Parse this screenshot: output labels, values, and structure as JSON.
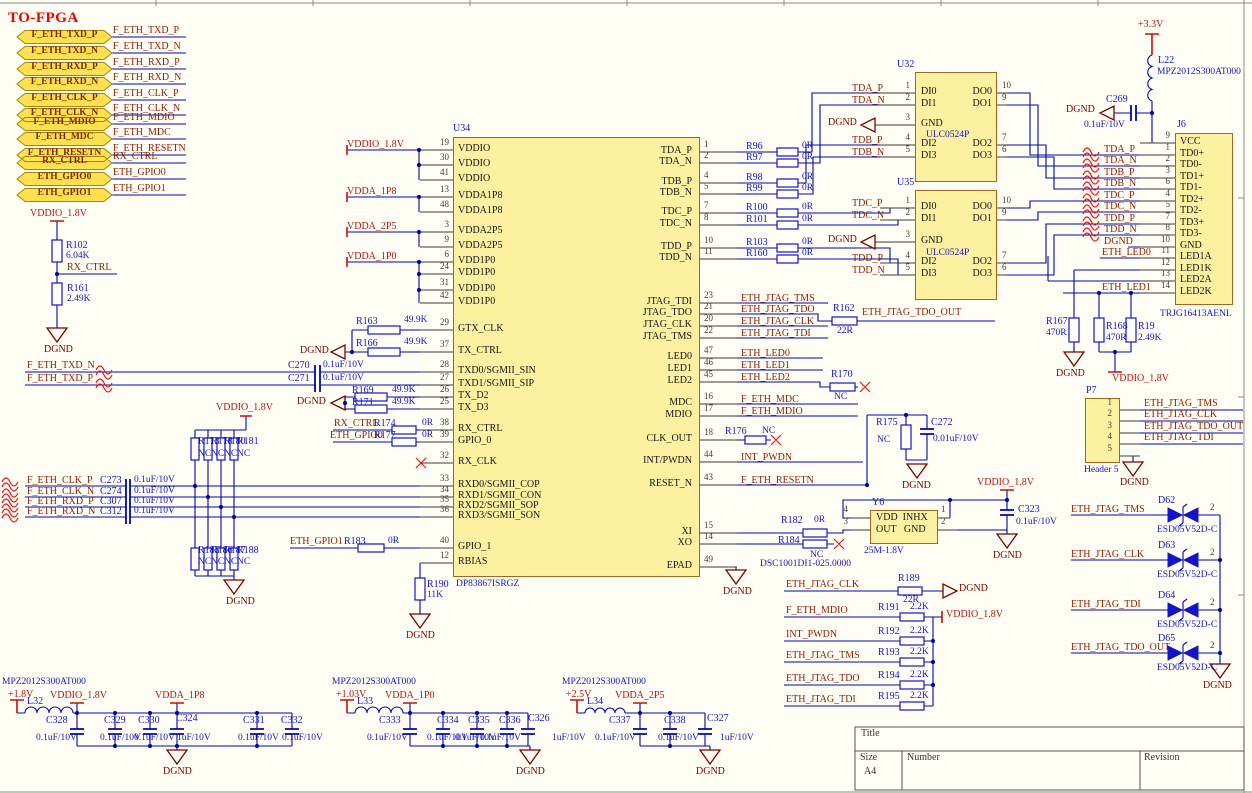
{
  "header": {
    "title": "TO-FPGA"
  },
  "ports": [
    {
      "label": "F_ETH_TXD_P"
    },
    {
      "label": "F_ETH_TXD_N"
    },
    {
      "label": "F_ETH_RXD_P"
    },
    {
      "label": "F_ETH_RXD_N"
    },
    {
      "label": "F_ETH_CLK_P"
    },
    {
      "label": "F_ETH_CLK_N"
    },
    {
      "label": "F_ETH_MDIO"
    },
    {
      "label": "F_ETH_MDC"
    },
    {
      "label": "F_ETH_RESETN"
    },
    {
      "label": "RX_CTRL"
    },
    {
      "label": "ETH_GPIO0"
    },
    {
      "label": "ETH_GPIO1"
    }
  ],
  "u34": {
    "ref": "U34",
    "part": "DP83867ISRGZ",
    "left_pins": [
      [
        "19",
        "VDDIO"
      ],
      [
        "30",
        "VDDIO"
      ],
      [
        "41",
        "VDDIO"
      ],
      [
        "13",
        "VDDA1P8"
      ],
      [
        "48",
        "VDDA1P8"
      ],
      [
        "3",
        "VDDA2P5"
      ],
      [
        "9",
        "VDDA2P5"
      ],
      [
        "6",
        "VDD1P0"
      ],
      [
        "24",
        "VDD1P0"
      ],
      [
        "31",
        "VDD1P0"
      ],
      [
        "42",
        "VDD1P0"
      ],
      [
        "29",
        "GTX_CLK"
      ],
      [
        "37",
        "TX_CTRL"
      ],
      [
        "28",
        "TXD0/SGMII_SIN"
      ],
      [
        "27",
        "TXD1/SGMII_SIP"
      ],
      [
        "26",
        "TX_D2"
      ],
      [
        "25",
        "TX_D3"
      ],
      [
        "38",
        "RX_CTRL"
      ],
      [
        "39",
        "GPIO_0"
      ],
      [
        "32",
        "RX_CLK"
      ],
      [
        "33",
        "RXD0/SGMII_COP"
      ],
      [
        "34",
        "RXD1/SGMII_CON"
      ],
      [
        "35",
        "RXD2/SGMII_SOP"
      ],
      [
        "36",
        "RXD3/SGMII_SON"
      ],
      [
        "40",
        "GPIO_1"
      ],
      [
        "12",
        "RBIAS"
      ]
    ],
    "right_pins": [
      [
        "1",
        "TDA_P"
      ],
      [
        "2",
        "TDA_N"
      ],
      [
        "4",
        "TDB_P"
      ],
      [
        "5",
        "TDB_N"
      ],
      [
        "7",
        "TDC_P"
      ],
      [
        "8",
        "TDC_N"
      ],
      [
        "10",
        "TDD_P"
      ],
      [
        "11",
        "TDD_N"
      ],
      [
        "23",
        "JTAG_TDI"
      ],
      [
        "21",
        "JTAG_TDO"
      ],
      [
        "20",
        "JTAG_CLK"
      ],
      [
        "22",
        "JTAG_TMS"
      ],
      [
        "47",
        "LED0"
      ],
      [
        "46",
        "LED1"
      ],
      [
        "45",
        "LED2"
      ],
      [
        "16",
        "MDC"
      ],
      [
        "17",
        "MDIO"
      ],
      [
        "18",
        "CLK_OUT"
      ],
      [
        "44",
        "INT/PWDN"
      ],
      [
        "43",
        "RESET_N"
      ],
      [
        "15",
        "XI"
      ],
      [
        "14",
        "XO"
      ],
      [
        "49",
        "EPAD"
      ]
    ]
  },
  "u34_right_nets": [
    "ETH_JTAG_TMS",
    "ETH_JTAG_TDO",
    "ETH_JTAG_CLK",
    "ETH_JTAG_TDI",
    "ETH_LED0",
    "ETH_LED1",
    "ETH_LED2",
    "F_ETH_MDC",
    "F_ETH_MDIO",
    "INT_PWDN",
    "F_ETH_RESETN"
  ],
  "u32": {
    "ref": "U32",
    "part": "ULC0524P",
    "left": [
      [
        "1",
        "DI0"
      ],
      [
        "2",
        "DI1"
      ],
      [
        "3",
        "GND"
      ],
      [
        "4",
        "DI2"
      ],
      [
        "5",
        "DI3"
      ]
    ],
    "right": [
      [
        "10",
        "DO0"
      ],
      [
        "9",
        "DO1"
      ],
      [
        "7",
        "DO2"
      ],
      [
        "6",
        "DO3"
      ]
    ]
  },
  "u35": {
    "ref": "U35",
    "part": "ULC0524P",
    "left": [
      [
        "1",
        "DI0"
      ],
      [
        "2",
        "DI1"
      ],
      [
        "3",
        "GND"
      ],
      [
        "4",
        "DI2"
      ],
      [
        "5",
        "DI3"
      ]
    ],
    "right": [
      [
        "10",
        "DO0"
      ],
      [
        "9",
        "DO1"
      ],
      [
        "7",
        "DO2"
      ],
      [
        "6",
        "DO3"
      ]
    ]
  },
  "series_r": [
    [
      "R96",
      "0R"
    ],
    [
      "R97",
      "0R"
    ],
    [
      "R98",
      "0R"
    ],
    [
      "R99",
      "0R"
    ],
    [
      "R100",
      "0R"
    ],
    [
      "R101",
      "0R"
    ],
    [
      "R103",
      "0R"
    ],
    [
      "R160",
      "0R"
    ]
  ],
  "pair_nets": [
    "TDA_P",
    "TDA_N",
    "TDB_P",
    "TDB_N",
    "TDC_P",
    "TDC_N",
    "TDD_P",
    "TDD_N"
  ],
  "j6": {
    "ref": "J6",
    "part": "TRJG16413AENL",
    "pins": [
      [
        "9",
        "VCC"
      ],
      [
        "1",
        "TD0+"
      ],
      [
        "2",
        "TD0-"
      ],
      [
        "3",
        "TD1+"
      ],
      [
        "6",
        "TD1-"
      ],
      [
        "4",
        "TD2+"
      ],
      [
        "5",
        "TD2-"
      ],
      [
        "7",
        "TD3+"
      ],
      [
        "8",
        "TD3-"
      ],
      [
        "10",
        "GND"
      ],
      [
        "11",
        "LED1A"
      ],
      [
        "12",
        "LED1K"
      ],
      [
        "13",
        "LED2A"
      ],
      [
        "14",
        "LED2K"
      ]
    ]
  },
  "p7": {
    "ref": "P7",
    "part": "Header 5",
    "pins": [
      "1",
      "2",
      "3",
      "4",
      "5"
    ],
    "nets": [
      "ETH_JTAG_TMS",
      "ETH_JTAG_CLK",
      "ETH_JTAG_TDO_OUT",
      "ETH_JTAG_TDI"
    ]
  },
  "esd": {
    "part": "ESD05V52D-C",
    "pin": "2",
    "rows": [
      [
        "D62",
        "ETH_JTAG_TMS"
      ],
      [
        "D63",
        "ETH_JTAG_CLK"
      ],
      [
        "D64",
        "ETH_JTAG_TDI"
      ],
      [
        "D65",
        "ETH_JTAG_TDO_OUT"
      ]
    ]
  },
  "pullups": {
    "value": "2.2K",
    "rail": "VDDIO_1.8V",
    "rows": [
      [
        "F_ETH_MDIO",
        "R191"
      ],
      [
        "INT_PWDN",
        "R192"
      ],
      [
        "ETH_JTAG_TMS",
        "R193"
      ],
      [
        "ETH_JTAG_TDO",
        "R194"
      ],
      [
        "ETH_JTAG_TDI",
        "R195"
      ]
    ]
  },
  "r189": {
    "net": "ETH_JTAG_CLK",
    "ref": "R189",
    "value": "22R"
  },
  "osc": {
    "ref": "Y6",
    "row1": "VDD  INHX",
    "row2": "OUT   GND",
    "pins": [
      "4",
      "3",
      "1",
      "2"
    ],
    "freq": "25M-1.8V",
    "part": "DSC1001DI1-025.0000"
  },
  "cap_groups": [
    {
      "part": "MPZ2012S300AT000",
      "vin": "+1.8V",
      "l": "L32",
      "rails": [
        "VDDIO_1.8V",
        "VDDA_1P8"
      ],
      "caps": [
        [
          "C328",
          "0.1uF/10V"
        ],
        [
          "C329",
          "0.1uF/10V"
        ],
        [
          "C330",
          "0.1uF/10V"
        ],
        [
          "C324",
          "1uF/10V"
        ],
        [
          "C331",
          "0.1uF/10V"
        ],
        [
          "C332",
          "0.1uF/10V"
        ]
      ]
    },
    {
      "part": "MPZ2012S300AT000",
      "vin": "+1.03V",
      "l": "L33",
      "rails": [
        "VDDA_1P0"
      ],
      "caps": [
        [
          "C333",
          "0.1uF/10V"
        ],
        [
          "C334",
          "0.1uF/10V"
        ],
        [
          "C335",
          "0.1uF/10V"
        ],
        [
          "C336",
          "0.1uF/10V"
        ],
        [
          "C326",
          "1uF/10V"
        ]
      ]
    },
    {
      "part": "MPZ2012S300AT000",
      "vin": "+2.5V",
      "l": "L34",
      "rails": [
        "VDDA_2P5"
      ],
      "caps": [
        [
          "C337",
          "0.1uF/10V"
        ],
        [
          "C338",
          "0.1uF/10V"
        ],
        [
          "C327",
          "1uF/10V"
        ]
      ]
    }
  ],
  "nc_banks": {
    "value": "NC",
    "rail": "VDDIO_1.8V",
    "top": [
      "R173",
      "R178",
      "R180",
      "R181"
    ],
    "bottom": [
      "R185",
      "R186",
      "R187",
      "R188"
    ]
  },
  "singles": {
    "r102": [
      "R102",
      "6.04K"
    ],
    "r161": [
      "R161",
      "2.49K"
    ],
    "r163": [
      "R163",
      "49.9K"
    ],
    "r166": [
      "R166",
      "49.9K"
    ],
    "r169": [
      "R169",
      "49.9K"
    ],
    "r171": [
      "R171",
      "49.9K"
    ],
    "r174": [
      "R174",
      "0R"
    ],
    "r177": [
      "R177",
      "0R"
    ],
    "r183": [
      "R183",
      "0R"
    ],
    "r190": [
      "R190",
      "11K"
    ],
    "r162": [
      "R162",
      "22R"
    ],
    "r170": [
      "R170",
      "NC"
    ],
    "r175": [
      "R175",
      "NC"
    ],
    "r176": [
      "R176",
      "NC"
    ],
    "r182": [
      "R182",
      "0R"
    ],
    "r184": [
      "R184",
      "NC"
    ],
    "r167": [
      "R167",
      "470R"
    ],
    "r168": [
      "R168",
      "470R"
    ],
    "r19": [
      "R19",
      "2.49K"
    ],
    "c269": [
      "C269",
      "0.1uF/10V"
    ],
    "c270": [
      "C270",
      "0.1uF/10V"
    ],
    "c271": [
      "C271",
      "0.1uF/10V"
    ],
    "c272": [
      "C272",
      "0.01uF/10V"
    ],
    "c273": [
      "C273",
      "0.1uF/10V"
    ],
    "c274": [
      "C274",
      "0.1uF/10V"
    ],
    "c307": [
      "C307",
      "0.1uF/10V"
    ],
    "c312": [
      "C312",
      "0.1uF/10V"
    ],
    "c323": [
      "C323",
      "0.1uF/10V"
    ],
    "l22": [
      "L22",
      "MPZ2012S300AT000"
    ]
  },
  "nets": {
    "vddio": "VDDIO_1.8V",
    "vdda1p8": "VDDA_1P8",
    "vdda2p5": "VDDA_2P5",
    "vdda1p0": "VDDA_1P0",
    "dgnd": "DGND",
    "p3v3": "+3.3V",
    "rx_ctrl": "RX_CTRL",
    "txd_n": "F_ETH_TXD_N",
    "txd_p": "F_ETH_TXD_P",
    "clk_p": "F_ETH_CLK_P",
    "clk_n": "F_ETH_CLK_N",
    "rxd_p": "F_ETH_RXD_P",
    "rxd_n": "F_ETH_RXD_N",
    "gpio0": "ETH_GPIO0",
    "gpio1": "ETH_GPIO1",
    "tdo_out": "ETH_JTAG_TDO_OUT",
    "led0": "ETH_LED0",
    "led1": "ETH_LED1"
  },
  "title_block": {
    "title": "Title",
    "size": "Size",
    "size_value": "A4",
    "number": "Number",
    "revision": "Revision"
  }
}
